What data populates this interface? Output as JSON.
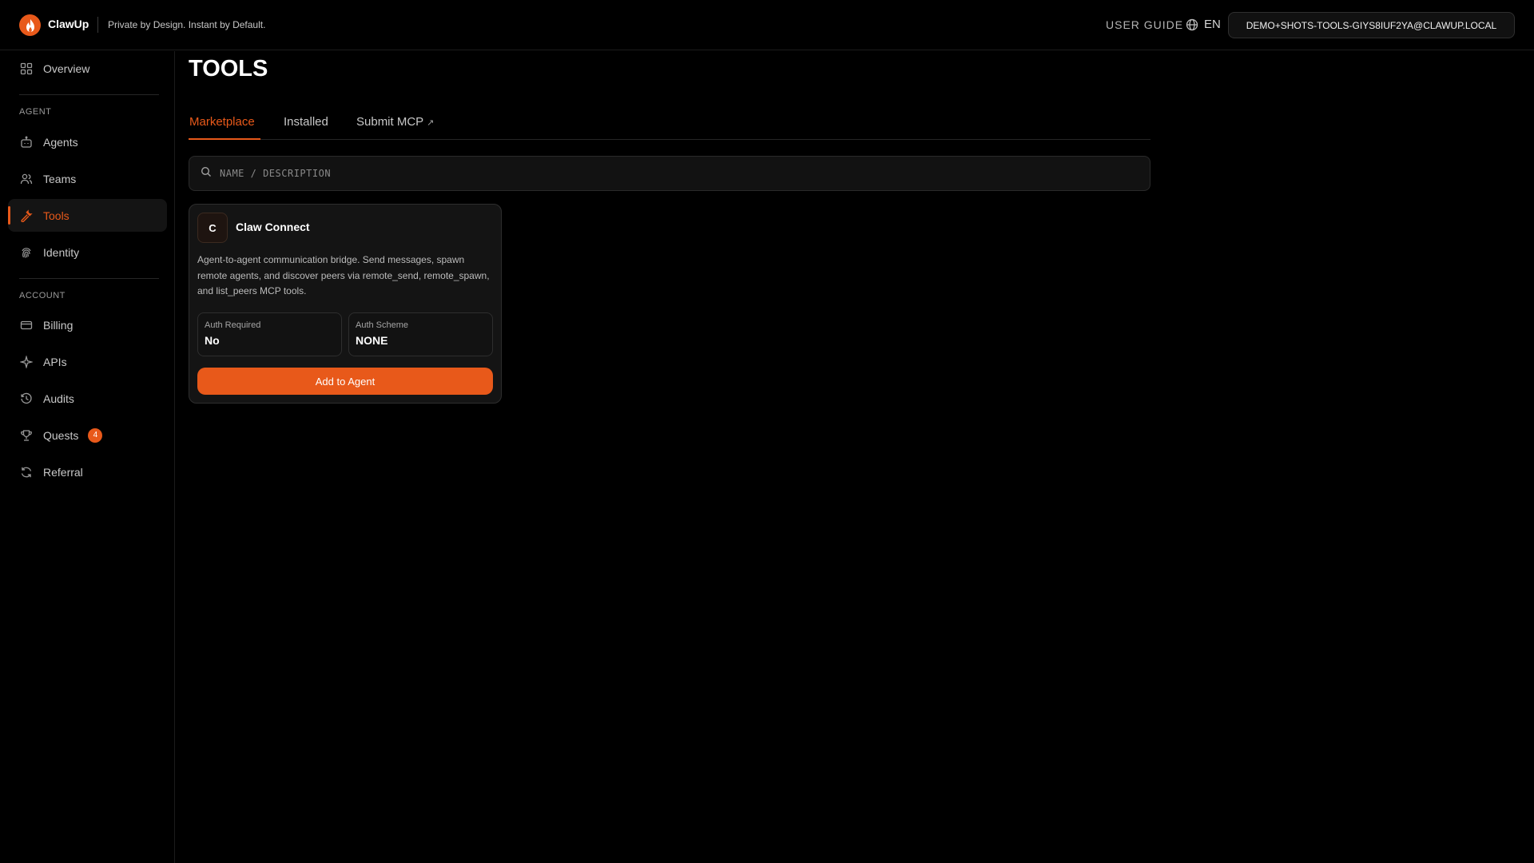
{
  "header": {
    "brand": "ClawUp",
    "tagline": "Private by Design. Instant by Default.",
    "user_guide": "USER GUIDE",
    "language": "EN",
    "email": "DEMO+SHOTS-TOOLS-GIYS8IUF2YA@CLAWUP.LOCAL"
  },
  "sidebar": {
    "overview": "Overview",
    "agent_section": "AGENT",
    "agent_items": [
      {
        "label": "Agents",
        "icon": "bot-icon"
      },
      {
        "label": "Teams",
        "icon": "users-icon"
      },
      {
        "label": "Tools",
        "icon": "wrench-icon",
        "active": true
      },
      {
        "label": "Identity",
        "icon": "fingerprint-icon"
      }
    ],
    "account_section": "ACCOUNT",
    "account_items": [
      {
        "label": "Billing",
        "icon": "credit-card-icon"
      },
      {
        "label": "APIs",
        "icon": "sparkle-icon"
      },
      {
        "label": "Audits",
        "icon": "history-icon"
      },
      {
        "label": "Quests",
        "icon": "trophy-icon",
        "badge": "4"
      },
      {
        "label": "Referral",
        "icon": "refresh-icon"
      }
    ]
  },
  "main": {
    "title": "TOOLS",
    "tabs": [
      {
        "label": "Marketplace",
        "active": true
      },
      {
        "label": "Installed"
      },
      {
        "label": "Submit MCP",
        "suffix": "↗"
      }
    ],
    "search": {
      "placeholder": "NAME / DESCRIPTION",
      "value": ""
    },
    "cards": [
      {
        "avatar": "C",
        "title": "Claw Connect",
        "description": "Agent-to-agent communication bridge. Send messages, spawn remote agents, and discover peers via remote_send, remote_spawn, and list_peers MCP tools.",
        "auth_required_label": "Auth Required",
        "auth_required_value": "No",
        "auth_scheme_label": "Auth Scheme",
        "auth_scheme_value": "NONE",
        "button": "Add to Agent"
      }
    ]
  },
  "colors": {
    "accent": "#e8591a",
    "background": "#000000"
  }
}
